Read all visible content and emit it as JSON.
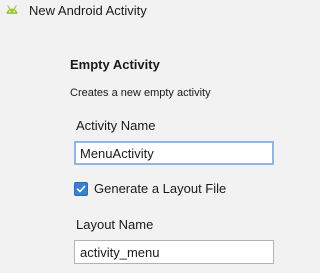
{
  "window": {
    "title": "New Android Activity",
    "icon": "android-icon",
    "icon_color": "#a4c639"
  },
  "template": {
    "heading": "Empty Activity",
    "description": "Creates a new empty activity"
  },
  "form": {
    "activity_name": {
      "label": "Activity Name",
      "value": "MenuActivity"
    },
    "generate_layout": {
      "label": "Generate a Layout File",
      "checked": true
    },
    "layout_name": {
      "label": "Layout Name",
      "value": "activity_menu"
    }
  },
  "colors": {
    "accent": "#3a7fd0",
    "focus_border": "#8fb5e0"
  }
}
